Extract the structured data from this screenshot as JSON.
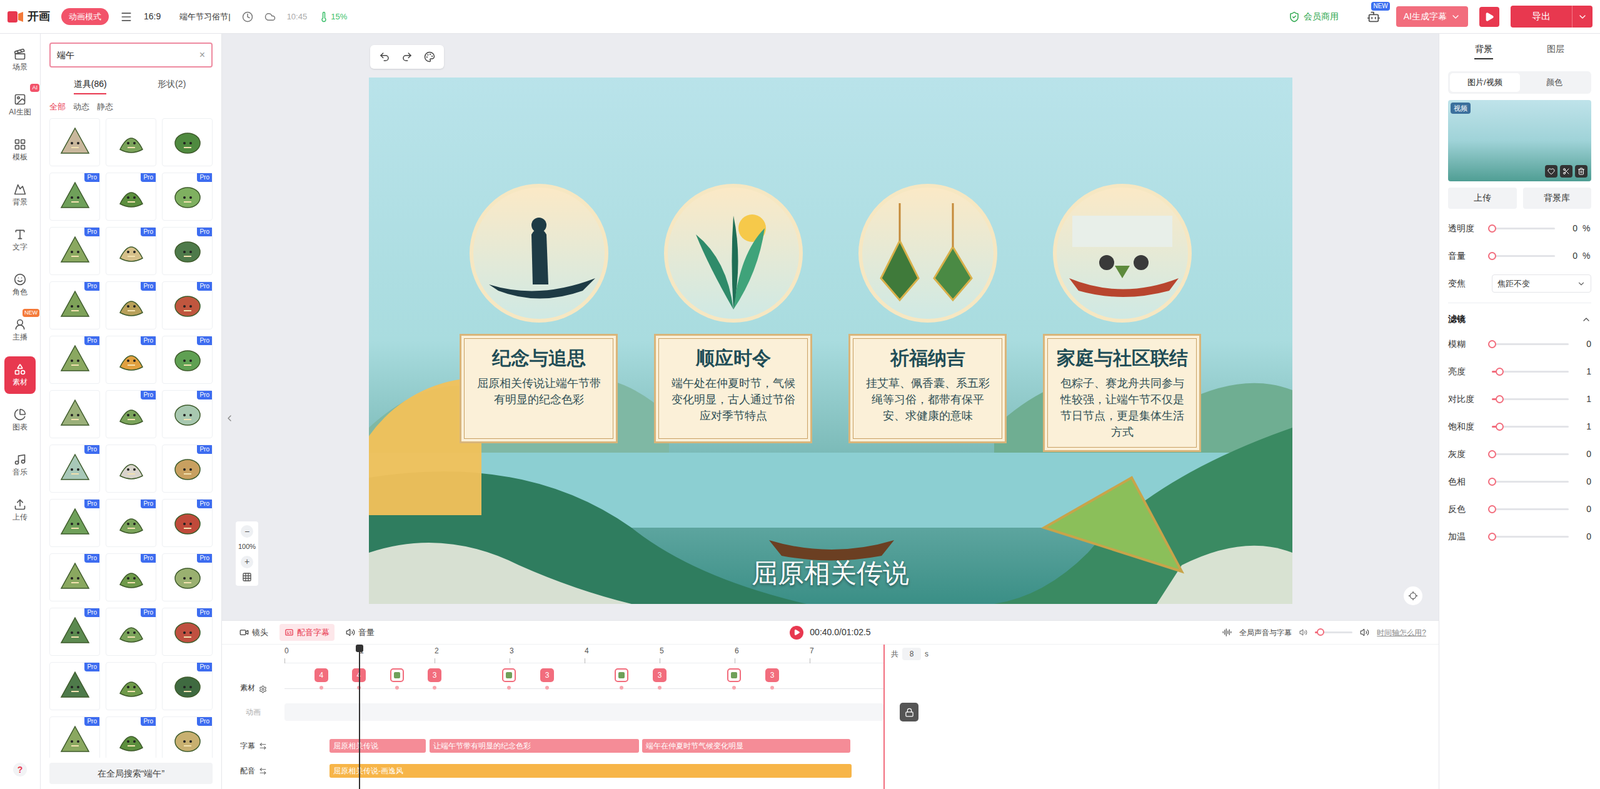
{
  "topbar": {
    "logo": "开画",
    "mode": "动画模式",
    "ratio": "16:9",
    "project_title": "端午节习俗节|",
    "save_time": "10:45",
    "progress": "15%",
    "commercial": "会员商用",
    "new_badge": "NEW",
    "ai_subtitle": "AI生成字幕",
    "export": "导出"
  },
  "rail": [
    {
      "label": "场景",
      "selected": false,
      "badge": ""
    },
    {
      "label": "AI生图",
      "selected": false,
      "badge": "AI"
    },
    {
      "label": "模板",
      "selected": false,
      "badge": ""
    },
    {
      "label": "背景",
      "selected": false,
      "badge": ""
    },
    {
      "label": "文字",
      "selected": false,
      "badge": ""
    },
    {
      "label": "角色",
      "selected": false,
      "badge": ""
    },
    {
      "label": "主播",
      "selected": false,
      "badge": "NEW"
    },
    {
      "label": "素材",
      "selected": true,
      "badge": ""
    },
    {
      "label": "图表",
      "selected": false,
      "badge": ""
    },
    {
      "label": "音乐",
      "selected": false,
      "badge": ""
    },
    {
      "label": "上传",
      "selected": false,
      "badge": ""
    }
  ],
  "rail_help": "?",
  "assets": {
    "search": "端午",
    "clear": "×",
    "tabs": [
      {
        "label": "道具(86)",
        "selected": true
      },
      {
        "label": "形状(2)",
        "selected": false
      }
    ],
    "filters": [
      {
        "label": "全部",
        "selected": true
      },
      {
        "label": "动态",
        "selected": false
      },
      {
        "label": "静态",
        "selected": false
      }
    ],
    "pro_label": "Pro",
    "items": [
      {
        "pro": false,
        "color": "#c9b79c"
      },
      {
        "pro": false,
        "color": "#7aa35a"
      },
      {
        "pro": false,
        "color": "#4f8a3f"
      },
      {
        "pro": true,
        "color": "#6fa05a"
      },
      {
        "pro": true,
        "color": "#5c8f3e"
      },
      {
        "pro": true,
        "color": "#7fb060"
      },
      {
        "pro": true,
        "color": "#8aa860"
      },
      {
        "pro": true,
        "color": "#d6c08a"
      },
      {
        "pro": true,
        "color": "#4e7a4a"
      },
      {
        "pro": true,
        "color": "#7ea259"
      },
      {
        "pro": true,
        "color": "#b8a05a"
      },
      {
        "pro": true,
        "color": "#c0563e"
      },
      {
        "pro": true,
        "color": "#8aa860"
      },
      {
        "pro": true,
        "color": "#e0a040"
      },
      {
        "pro": true,
        "color": "#5fa052"
      },
      {
        "pro": false,
        "color": "#9bb07a"
      },
      {
        "pro": true,
        "color": "#7aa35a"
      },
      {
        "pro": true,
        "color": "#a8c8b0"
      },
      {
        "pro": true,
        "color": "#a8c8b8"
      },
      {
        "pro": false,
        "color": "#d9d4cc"
      },
      {
        "pro": true,
        "color": "#c8a060"
      },
      {
        "pro": true,
        "color": "#6fa05a"
      },
      {
        "pro": true,
        "color": "#7aa35a"
      },
      {
        "pro": true,
        "color": "#c04a3a"
      },
      {
        "pro": true,
        "color": "#8aa860"
      },
      {
        "pro": true,
        "color": "#6f9a4a"
      },
      {
        "pro": true,
        "color": "#9ab070"
      },
      {
        "pro": true,
        "color": "#5c8a50"
      },
      {
        "pro": true,
        "color": "#7aa35a"
      },
      {
        "pro": true,
        "color": "#c05040"
      },
      {
        "pro": true,
        "color": "#4e7a4a"
      },
      {
        "pro": false,
        "color": "#6f9a4a"
      },
      {
        "pro": true,
        "color": "#3f6a40"
      },
      {
        "pro": true,
        "color": "#8aa860"
      },
      {
        "pro": true,
        "color": "#5c8f3e"
      },
      {
        "pro": true,
        "color": "#c8b070"
      }
    ],
    "global_search": "在全局搜索“端午”"
  },
  "canvas": {
    "zoom": "100%",
    "zoom_out": "−",
    "zoom_in": "+",
    "cards": [
      {
        "title": "纪念与追思",
        "body": "屈原相关传说让端午节带有明显的纪念色彩"
      },
      {
        "title": "顺应时令",
        "body": "端午处在仲夏时节，气候变化明显，古人通过节俗应对季节特点"
      },
      {
        "title": "祈福纳吉",
        "body": "挂艾草、佩香囊、系五彩绳等习俗，都带有保平安、求健康的意味"
      },
      {
        "title": "家庭与社区联结",
        "body": "包粽子、赛龙舟共同参与性较强，让端午节不仅是节日节点，更是集体生活方式"
      }
    ],
    "subtitle": "屈原相关传说"
  },
  "timeline": {
    "tabs": [
      {
        "label": "镜头",
        "selected": false
      },
      {
        "label": "配音字幕",
        "selected": true
      },
      {
        "label": "音量",
        "selected": false
      }
    ],
    "time": "00:40.0/01:02.5",
    "global_audio": "全局声音与字幕",
    "global_volume": 0.15,
    "help": "时间轴怎么用?",
    "ruler": [
      "0",
      "1",
      "2",
      "3",
      "4",
      "5",
      "6",
      "7"
    ],
    "total_prefix": "共",
    "total": "8",
    "total_unit": "s",
    "duration": 8,
    "playhead": 1.0,
    "track_labels": [
      "素材",
      "动画",
      "字幕",
      "配音"
    ],
    "markers": [
      {
        "time": 0.49,
        "kind": "number",
        "label": "4"
      },
      {
        "time": 0.99,
        "kind": "number",
        "label": "4"
      },
      {
        "time": 1.5,
        "kind": "image",
        "label": ""
      },
      {
        "time": 2.0,
        "kind": "number",
        "label": "3"
      },
      {
        "time": 2.99,
        "kind": "image",
        "label": ""
      },
      {
        "time": 3.5,
        "kind": "number",
        "label": "3"
      },
      {
        "time": 4.49,
        "kind": "image",
        "label": ""
      },
      {
        "time": 5.0,
        "kind": "number",
        "label": "3"
      },
      {
        "time": 5.99,
        "kind": "image",
        "label": ""
      },
      {
        "time": 6.5,
        "kind": "number",
        "label": "3"
      }
    ],
    "subtitle_clips": [
      {
        "text": "屈原相关传说",
        "start": 0.6,
        "end": 1.9
      },
      {
        "text": "让端午节带有明显的纪念色彩",
        "start": 1.93,
        "end": 4.74
      },
      {
        "text": "端午在仲夏时节气候变化明显",
        "start": 4.77,
        "end": 7.56
      }
    ],
    "voice_clips": [
      {
        "text": "屈原相关传说-画逸风",
        "start": 0.6,
        "end": 7.56
      }
    ]
  },
  "right_panel": {
    "tabs": [
      {
        "label": "背景",
        "selected": true
      },
      {
        "label": "图层",
        "selected": false
      }
    ],
    "source_tabs": [
      {
        "label": "图片/视频",
        "selected": true
      },
      {
        "label": "颜色",
        "selected": false
      }
    ],
    "thumb_label": "视频",
    "buttons": [
      "上传",
      "背景库"
    ],
    "controls": [
      {
        "label": "透明度",
        "level": 0,
        "value": "0",
        "unit": "%"
      },
      {
        "label": "音量",
        "level": 0,
        "value": "0",
        "unit": "%"
      }
    ],
    "zoom_label": "变焦",
    "zoom_value": "焦距不变",
    "filter_title": "滤镜",
    "filter_expanded": true,
    "filters": [
      {
        "label": "模糊",
        "level": 0,
        "value": "0"
      },
      {
        "label": "亮度",
        "level": 0.1,
        "value": "1"
      },
      {
        "label": "对比度",
        "level": 0.1,
        "value": "1"
      },
      {
        "label": "饱和度",
        "level": 0.1,
        "value": "1"
      },
      {
        "label": "灰度",
        "level": 0,
        "value": "0"
      },
      {
        "label": "色相",
        "level": 0,
        "value": "0"
      },
      {
        "label": "反色",
        "level": 0,
        "value": "0"
      },
      {
        "label": "加温",
        "level": 0,
        "value": "0"
      }
    ]
  }
}
